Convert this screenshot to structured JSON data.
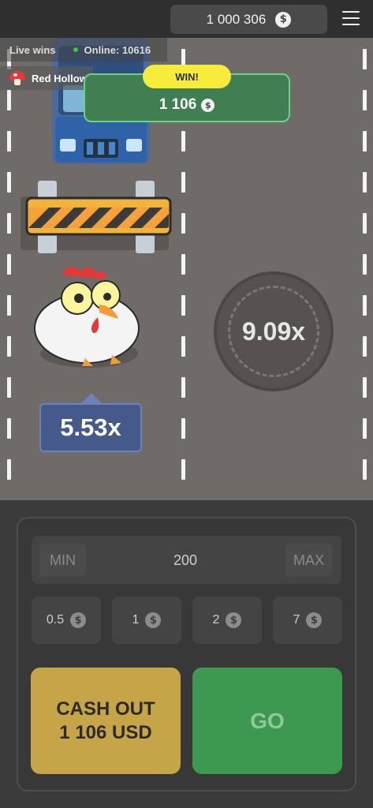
{
  "header": {
    "balance": "1 000 306",
    "currency_symbol": "$",
    "menu_icon": "hamburger-icon"
  },
  "live": {
    "label": "Live wins",
    "online": "Online: 10616",
    "recent_player": "Red Hollow"
  },
  "win": {
    "badge": "WIN!",
    "amount": "1 106"
  },
  "board": {
    "next_multiplier": "9.09x",
    "current_multiplier": "5.53x"
  },
  "bet": {
    "min_label": "MIN",
    "max_label": "MAX",
    "value": "200",
    "chips": [
      "0.5",
      "1",
      "2",
      "7"
    ]
  },
  "actions": {
    "cashout_line1": "CASH OUT",
    "cashout_line2": "1 106 USD",
    "go_label": "GO"
  },
  "colors": {
    "road": "#6e6b69",
    "win_badge": "#f7ec3b",
    "cashout": "#c6a448",
    "go": "#3d9852",
    "multiplier": "#45598a"
  }
}
